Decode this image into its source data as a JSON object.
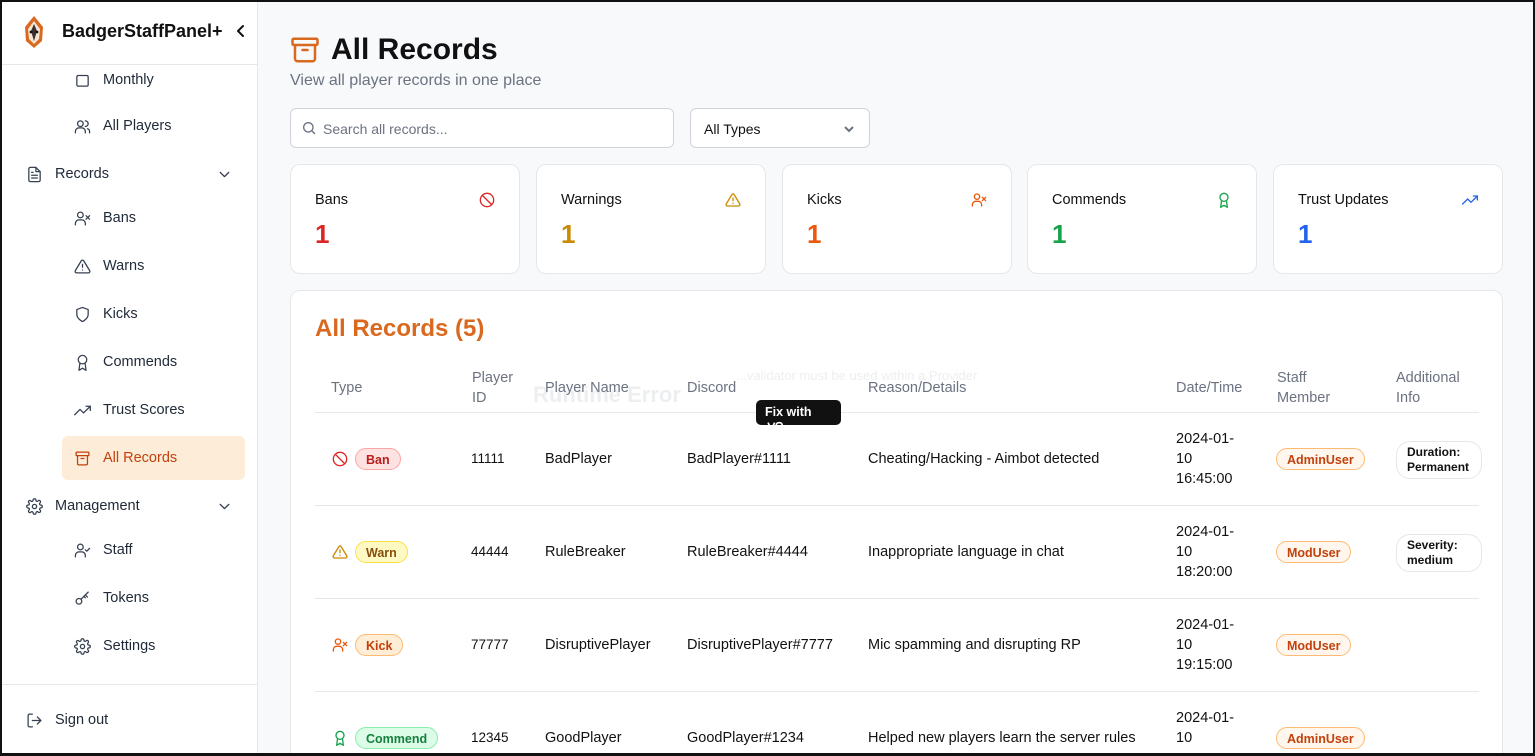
{
  "brand": {
    "name": "BadgerStaffPanel+"
  },
  "sidebar": {
    "partial_item": "Monthly",
    "items": [
      {
        "label": "All Players",
        "icon": "users-icon"
      },
      {
        "label": "Records",
        "icon": "file-text-icon",
        "group": true
      },
      {
        "label": "Bans",
        "icon": "user-x-icon"
      },
      {
        "label": "Warns",
        "icon": "alert-triangle-icon"
      },
      {
        "label": "Kicks",
        "icon": "shield-icon"
      },
      {
        "label": "Commends",
        "icon": "award-icon"
      },
      {
        "label": "Trust Scores",
        "icon": "trending-up-icon"
      },
      {
        "label": "All Records",
        "icon": "archive-icon",
        "active": true
      },
      {
        "label": "Management",
        "icon": "gear-icon",
        "group": true
      },
      {
        "label": "Staff",
        "icon": "user-check-icon"
      },
      {
        "label": "Tokens",
        "icon": "key-icon"
      },
      {
        "label": "Settings",
        "icon": "gear-icon"
      }
    ],
    "sign_out": "Sign out"
  },
  "header": {
    "title": "All Records",
    "subtitle": "View all player records in one place"
  },
  "filters": {
    "search_placeholder": "Search all records...",
    "type_selected": "All Types"
  },
  "stats": [
    {
      "label": "Bans",
      "value": "1",
      "color": "#dc2626",
      "icon": "ban-icon"
    },
    {
      "label": "Warnings",
      "value": "1",
      "color": "#ca8a04",
      "icon": "alert-triangle-icon"
    },
    {
      "label": "Kicks",
      "value": "1",
      "color": "#ea580c",
      "icon": "user-x-icon"
    },
    {
      "label": "Commends",
      "value": "1",
      "color": "#16a34a",
      "icon": "award-icon"
    },
    {
      "label": "Trust Updates",
      "value": "1",
      "color": "#2563eb",
      "icon": "trending-up-icon"
    }
  ],
  "records": {
    "title": "All Records (5)",
    "columns": {
      "type": "Type",
      "player_id_1": "Player",
      "player_id_2": "ID",
      "player_name": "Player Name",
      "discord": "Discord",
      "reason": "Reason/Details",
      "datetime": "Date/Time",
      "staff_1": "Staff",
      "staff_2": "Member",
      "info_1": "Additional",
      "info_2": "Info"
    },
    "rows": [
      {
        "type": "Ban",
        "id": "11111",
        "name": "BadPlayer",
        "discord": "BadPlayer#1111",
        "reason": "Cheating/Hacking - Aimbot detected",
        "date": "2024-01-",
        "date2": "10",
        "time": "16:45:00",
        "staff": "AdminUser",
        "info1": "Duration:",
        "info2": "Permanent"
      },
      {
        "type": "Warn",
        "id": "44444",
        "name": "RuleBreaker",
        "discord": "RuleBreaker#4444",
        "reason": "Inappropriate language in chat",
        "date": "2024-01-",
        "date2": "10",
        "time": "18:20:00",
        "staff": "ModUser",
        "info1": "Severity:",
        "info2": "medium"
      },
      {
        "type": "Kick",
        "id": "77777",
        "name": "DisruptivePlayer",
        "discord": "DisruptivePlayer#7777",
        "reason": "Mic spamming and disrupting RP",
        "date": "2024-01-",
        "date2": "10",
        "time": "19:15:00",
        "staff": "ModUser",
        "info1": "",
        "info2": ""
      },
      {
        "type": "Commend",
        "id": "12345",
        "name": "GoodPlayer",
        "discord": "GoodPlayer#1234",
        "reason": "Helped new players learn the server rules",
        "date": "2024-01-",
        "date2": "10",
        "time": "",
        "staff": "AdminUser",
        "info1": "",
        "info2": ""
      }
    ]
  },
  "overlay": {
    "error_title": "Runtime Error",
    "error_msg": "...validator must be used within a Provider",
    "fix_button": "Fix with"
  },
  "colors": {
    "accent": "#d9691f",
    "ban": "#dc2626",
    "warn": "#ca8a04",
    "kick": "#ea580c",
    "commend": "#16a34a",
    "trust": "#2563eb"
  }
}
